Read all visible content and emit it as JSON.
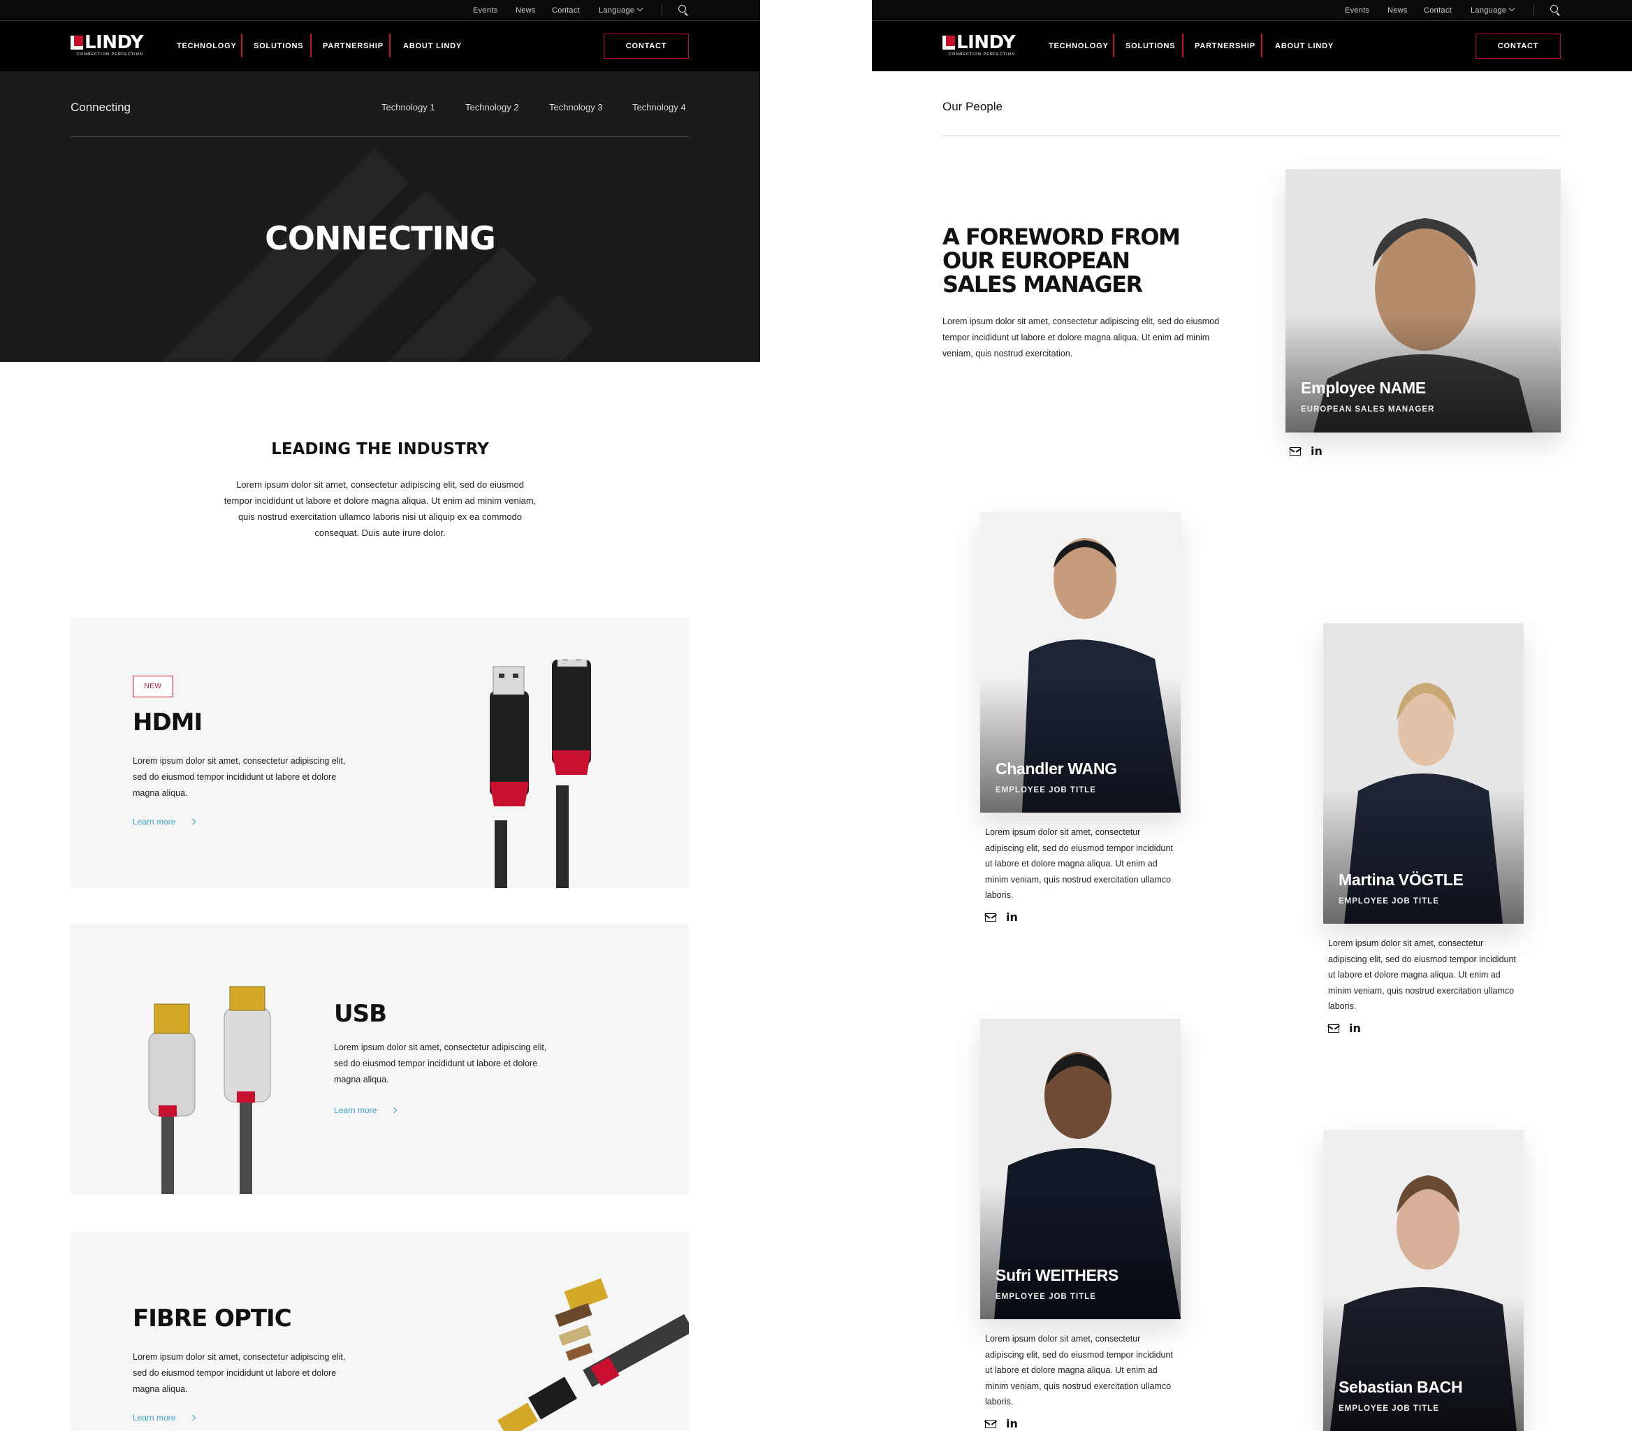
{
  "brand": {
    "logo_text": "LINDY",
    "tagline": "CONNECTION PERFECTION"
  },
  "utility": {
    "events": "Events",
    "news": "News",
    "contact": "Contact",
    "language": "Language"
  },
  "nav": {
    "technology": "TECHNOLOGY",
    "solutions": "SOLUTIONS",
    "partnership": "PARTNERSHIP",
    "about": "ABOUT LINDY",
    "contact_button": "CONTACT"
  },
  "left": {
    "subnav": {
      "title": "Connecting",
      "items": [
        "Technology 1",
        "Technology 2",
        "Technology 3",
        "Technology 4"
      ]
    },
    "hero_title": "CONNECTING",
    "intro": {
      "title": "LEADING THE INDUSTRY",
      "body": "Lorem ipsum dolor sit amet, consectetur adipiscing elit, sed do eiusmod tempor incididunt ut labore et dolore magna aliqua. Ut enim ad minim veniam, quis nostrud exercitation ullamco laboris nisi ut aliquip ex ea commodo consequat. Duis aute irure dolor."
    },
    "products": [
      {
        "badge": "NEW",
        "title": "HDMI",
        "body": "Lorem ipsum dolor sit amet, consectetur adipiscing elit, sed do eiusmod tempor incididunt ut labore et dolore magna aliqua.",
        "link": "Learn more"
      },
      {
        "title": "USB",
        "body": "Lorem ipsum dolor sit amet, consectetur adipiscing elit, sed do eiusmod tempor incididunt ut labore et dolore magna aliqua.",
        "link": "Learn more"
      },
      {
        "title": "FIBRE OPTIC",
        "body": "Lorem ipsum dolor sit amet, consectetur adipiscing elit, sed do eiusmod tempor incididunt ut labore et dolore magna aliqua.",
        "link": "Learn more"
      }
    ]
  },
  "right": {
    "section_title": "Our People",
    "foreword": {
      "title": "A FOREWORD FROM OUR EUROPEAN SALES MANAGER",
      "body": "Lorem ipsum dolor sit amet, consectetur adipiscing elit, sed do eiusmod tempor incididunt ut labore et dolore magna aliqua. Ut enim ad minim veniam, quis nostrud exercitation."
    },
    "manager": {
      "name": "Employee NAME",
      "title": "EUROPEAN SALES MANAGER"
    },
    "people": [
      {
        "name": "Chandler WANG",
        "title": "EMPLOYEE JOB TITLE",
        "desc": "Lorem ipsum dolor sit amet, consectetur adipiscing elit, sed do eiusmod tempor incididunt ut labore et dolore magna aliqua. Ut enim ad minim veniam, quis nostrud exercitation ullamco laboris."
      },
      {
        "name": "Martina VÖGTLE",
        "title": "EMPLOYEE JOB TITLE",
        "desc": "Lorem ipsum dolor sit amet, consectetur adipiscing elit, sed do eiusmod tempor incididunt ut labore et dolore magna aliqua. Ut enim ad minim veniam, quis nostrud exercitation ullamco laboris."
      },
      {
        "name": "Sufri WEITHERS",
        "title": "EMPLOYEE JOB TITLE",
        "desc": "Lorem ipsum dolor sit amet, consectetur adipiscing elit, sed do eiusmod tempor incididunt ut labore et dolore magna aliqua. Ut enim ad minim veniam, quis nostrud exercitation ullamco laboris."
      },
      {
        "name": "Sebastian BACH",
        "title": "EMPLOYEE JOB TITLE"
      }
    ]
  },
  "colors": {
    "brand_red": "#c8102e",
    "link_blue": "#3aa3d3",
    "hero_bg": "#1b1b1b",
    "nav_bg": "#000000",
    "card_bg": "#f6f6f6"
  },
  "icons": [
    "search-icon",
    "chevron-down-icon",
    "chevron-right-icon",
    "mail-icon",
    "linkedin-icon"
  ]
}
